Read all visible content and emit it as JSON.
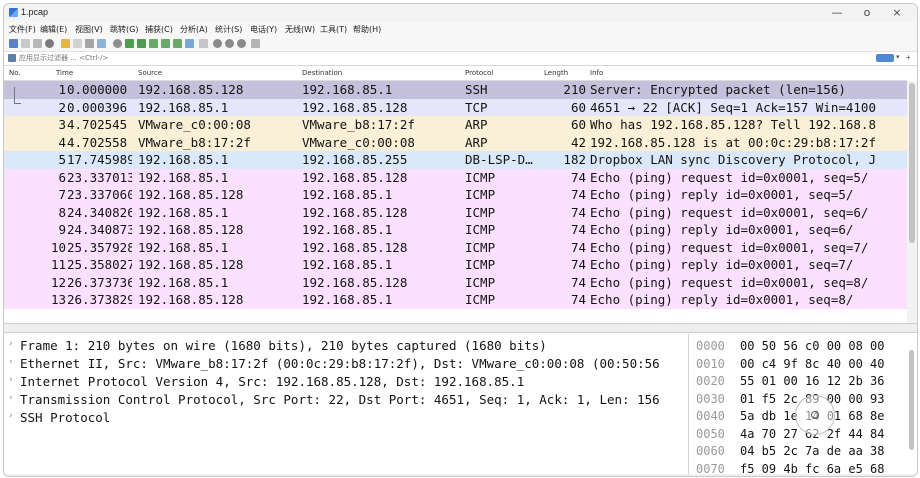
{
  "window": {
    "title": "1.pcap",
    "controls": {
      "minimize": "—",
      "restore": "ο",
      "close": "×"
    }
  },
  "menu": [
    "文件(F)",
    "编辑(E)",
    "视图(V)",
    "跳转(G)",
    "捕获(C)",
    "分析(A)",
    "统计(S)",
    "电话(Y)",
    "无线(W)",
    "工具(T)",
    "帮助(H)"
  ],
  "filter": {
    "placeholder": "应用显示过滤器 ... <Ctrl-/>",
    "apply_icon": "arrow-right-icon",
    "dropdown_icon": "chevron-down-icon",
    "add_label": "+"
  },
  "packet_list": {
    "columns": [
      "No.",
      "Time",
      "Source",
      "Destination",
      "Protocol",
      "Length",
      "Info"
    ],
    "rows": [
      {
        "no": "1",
        "time": "0.000000",
        "source": "192.168.85.128",
        "destination": "192.168.85.1",
        "protocol": "SSH",
        "length": "210",
        "info": "Server: Encrypted packet (len=156)",
        "color": "#c5c1dc"
      },
      {
        "no": "2",
        "time": "0.000396",
        "source": "192.168.85.1",
        "destination": "192.168.85.128",
        "protocol": "TCP",
        "length": "60",
        "info": "4651 → 22 [ACK] Seq=1 Ack=157 Win=4100",
        "color": "#e6e6fb"
      },
      {
        "no": "3",
        "time": "4.702545",
        "source": "VMware_c0:00:08",
        "destination": "VMware_b8:17:2f",
        "protocol": "ARP",
        "length": "60",
        "info": "Who has 192.168.85.128? Tell 192.168.8",
        "color": "#faf0d7"
      },
      {
        "no": "4",
        "time": "4.702558",
        "source": "VMware_b8:17:2f",
        "destination": "VMware_c0:00:08",
        "protocol": "ARP",
        "length": "42",
        "info": "192.168.85.128 is at 00:0c:29:b8:17:2f",
        "color": "#faf0d7"
      },
      {
        "no": "5",
        "time": "17.745989",
        "source": "192.168.85.1",
        "destination": "192.168.85.255",
        "protocol": "DB-LSP-D…",
        "length": "182",
        "info": "Dropbox LAN sync Discovery Protocol, J",
        "color": "#dae8fa"
      },
      {
        "no": "6",
        "time": "23.337013",
        "source": "192.168.85.1",
        "destination": "192.168.85.128",
        "protocol": "ICMP",
        "length": "74",
        "info": "Echo (ping) request  id=0x0001, seq=5/",
        "color": "#fce0ff"
      },
      {
        "no": "7",
        "time": "23.337060",
        "source": "192.168.85.128",
        "destination": "192.168.85.1",
        "protocol": "ICMP",
        "length": "74",
        "info": "Echo (ping) reply    id=0x0001, seq=5/",
        "color": "#fce0ff"
      },
      {
        "no": "8",
        "time": "24.340826",
        "source": "192.168.85.1",
        "destination": "192.168.85.128",
        "protocol": "ICMP",
        "length": "74",
        "info": "Echo (ping) request  id=0x0001, seq=6/",
        "color": "#fce0ff"
      },
      {
        "no": "9",
        "time": "24.340873",
        "source": "192.168.85.128",
        "destination": "192.168.85.1",
        "protocol": "ICMP",
        "length": "74",
        "info": "Echo (ping) reply    id=0x0001, seq=6/",
        "color": "#fce0ff"
      },
      {
        "no": "10",
        "time": "25.357928",
        "source": "192.168.85.1",
        "destination": "192.168.85.128",
        "protocol": "ICMP",
        "length": "74",
        "info": "Echo (ping) request  id=0x0001, seq=7/",
        "color": "#fce0ff"
      },
      {
        "no": "11",
        "time": "25.358027",
        "source": "192.168.85.128",
        "destination": "192.168.85.1",
        "protocol": "ICMP",
        "length": "74",
        "info": "Echo (ping) reply    id=0x0001, seq=7/",
        "color": "#fce0ff"
      },
      {
        "no": "12",
        "time": "26.373736",
        "source": "192.168.85.1",
        "destination": "192.168.85.128",
        "protocol": "ICMP",
        "length": "74",
        "info": "Echo (ping) request  id=0x0001, seq=8/",
        "color": "#fce0ff"
      },
      {
        "no": "13",
        "time": "26.373829",
        "source": "192.168.85.128",
        "destination": "192.168.85.1",
        "protocol": "ICMP",
        "length": "74",
        "info": "Echo (ping) reply    id=0x0001, seq=8/",
        "color": "#fce0ff"
      }
    ]
  },
  "details": [
    "Frame 1: 210 bytes on wire (1680 bits), 210 bytes captured (1680 bits)",
    "Ethernet II, Src: VMware_b8:17:2f (00:0c:29:b8:17:2f), Dst: VMware_c0:00:08 (00:50:56",
    "Internet Protocol Version 4, Src: 192.168.85.128, Dst: 192.168.85.1",
    "Transmission Control Protocol, Src Port: 22, Dst Port: 4651, Seq: 1, Ack: 1, Len: 156",
    "SSH Protocol"
  ],
  "hex": [
    {
      "offset": "0000",
      "bytes": "00 50 56 c0 00 08 00"
    },
    {
      "offset": "0010",
      "bytes": "00 c4 9f 8c 40 00 40"
    },
    {
      "offset": "0020",
      "bytes": "55 01 00 16 12 2b 36"
    },
    {
      "offset": "0030",
      "bytes": "01 f5 2c 89 00 00 93"
    },
    {
      "offset": "0040",
      "bytes": "5a db 1e 14 01 68 8e"
    },
    {
      "offset": "0050",
      "bytes": "4a 70 27 62 2f 44 84"
    },
    {
      "offset": "0060",
      "bytes": "04 b5 2c 7a de aa 38"
    },
    {
      "offset": "0070",
      "bytes": "f5 09 4b fc 6a e5 68"
    }
  ]
}
